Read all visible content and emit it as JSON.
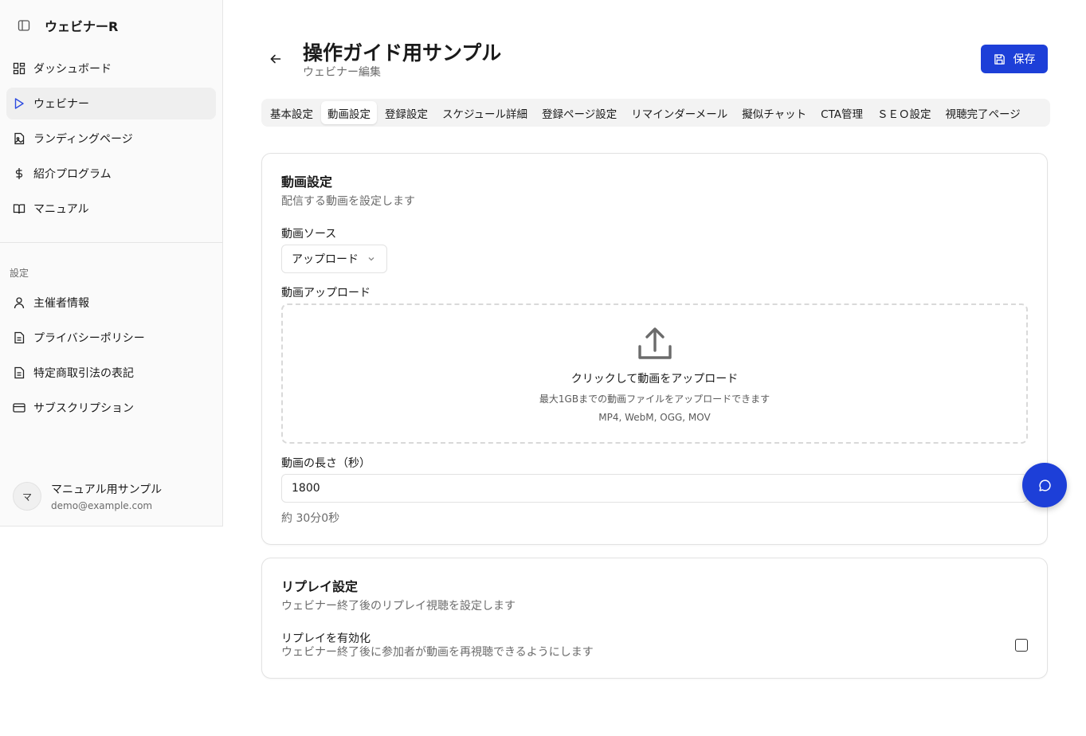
{
  "app": {
    "name": "ウェビナーR"
  },
  "sidebar": {
    "items": [
      {
        "label": "ダッシュボード",
        "icon": "dashboard-icon"
      },
      {
        "label": "ウェビナー",
        "icon": "play-icon",
        "active": true
      },
      {
        "label": "ランディングページ",
        "icon": "file-image-icon"
      },
      {
        "label": "紹介プログラム",
        "icon": "dollar-icon"
      },
      {
        "label": "マニュアル",
        "icon": "book-icon"
      }
    ],
    "settings_label": "設定",
    "settings_items": [
      {
        "label": "主催者情報",
        "icon": "user-icon"
      },
      {
        "label": "プライバシーポリシー",
        "icon": "document-icon"
      },
      {
        "label": "特定商取引法の表記",
        "icon": "document-icon"
      },
      {
        "label": "サブスクリプション",
        "icon": "credit-card-icon"
      }
    ],
    "user": {
      "initial": "マ",
      "name": "マニュアル用サンプル",
      "email": "demo@example.com"
    }
  },
  "header": {
    "title": "操作ガイド用サンプル",
    "subtitle": "ウェビナー編集",
    "save_label": "保存"
  },
  "tabs": [
    {
      "label": "基本設定"
    },
    {
      "label": "動画設定",
      "active": true
    },
    {
      "label": "登録設定"
    },
    {
      "label": "スケジュール詳細"
    },
    {
      "label": "登録ページ設定"
    },
    {
      "label": "リマインダーメール"
    },
    {
      "label": "擬似チャット"
    },
    {
      "label": "CTA管理"
    },
    {
      "label": "ＳＥＯ設定"
    },
    {
      "label": "視聴完了ページ"
    }
  ],
  "video_card": {
    "title": "動画設定",
    "description": "配信する動画を設定します",
    "source_label": "動画ソース",
    "source_value": "アップロード",
    "upload_label": "動画アップロード",
    "upload_main": "クリックして動画をアップロード",
    "upload_sub": "最大1GBまでの動画ファイルをアップロードできます",
    "upload_formats": "MP4, WebM, OGG, MOV",
    "length_label": "動画の長さ（秒）",
    "length_value": "1800",
    "length_hint": "約 30分0秒"
  },
  "replay_card": {
    "title": "リプレイ設定",
    "description": "ウェビナー終了後のリプレイ視聴を設定します",
    "toggle_label": "リプレイを有効化",
    "toggle_desc": "ウェビナー終了後に参加者が動画を再視聴できるようにします",
    "enabled": false
  },
  "colors": {
    "accent": "#1d3fd8",
    "active_icon": "#2d4be0"
  }
}
